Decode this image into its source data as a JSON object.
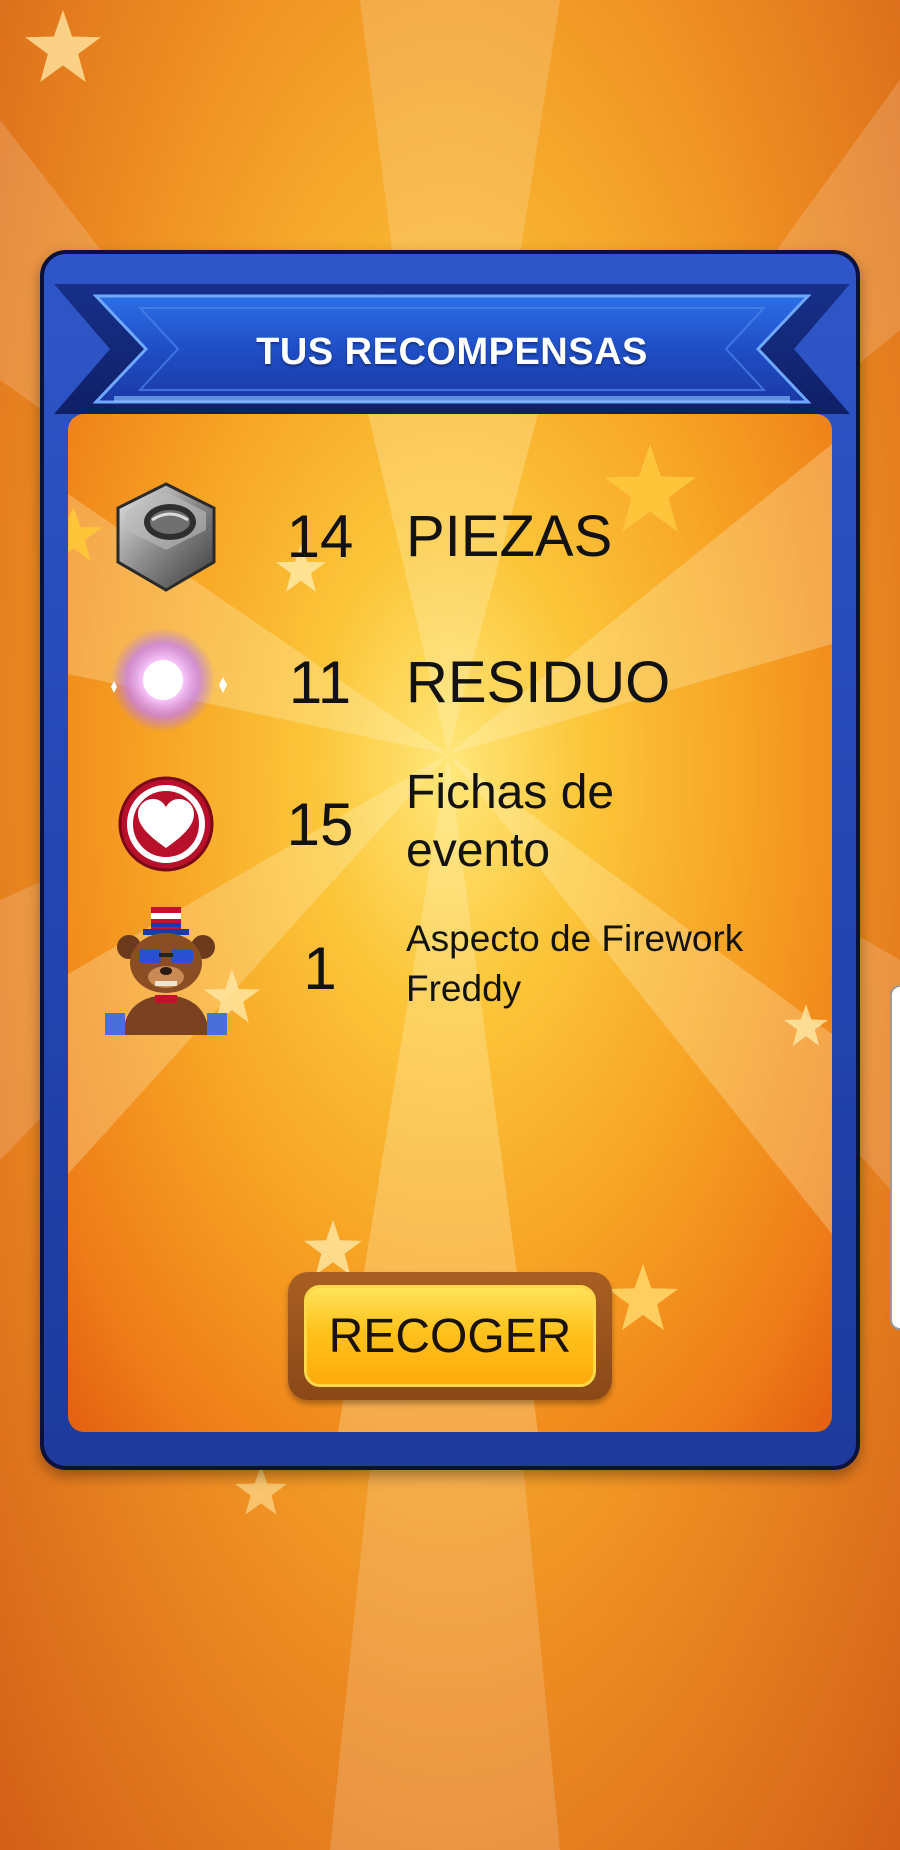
{
  "panel": {
    "title": "TUS RECOMPENSAS"
  },
  "rewards": [
    {
      "icon": "hex-nut-icon",
      "quantity": "14",
      "name": "PIEZAS"
    },
    {
      "icon": "sparkle-orb-icon",
      "quantity": "11",
      "name": "RESIDUO"
    },
    {
      "icon": "heart-token-icon",
      "quantity": "15",
      "name": "Fichas de evento"
    },
    {
      "icon": "freddy-character-icon",
      "quantity": "1",
      "name": "Aspecto de Firework Freddy"
    }
  ],
  "actions": {
    "collect_label": "RECOGER"
  },
  "colors": {
    "background": "#f4a82c",
    "panel_border": "#2a4fc4",
    "panel_outline": "#0a123c",
    "button_fill": "#ffc21d",
    "text": "#121212"
  }
}
